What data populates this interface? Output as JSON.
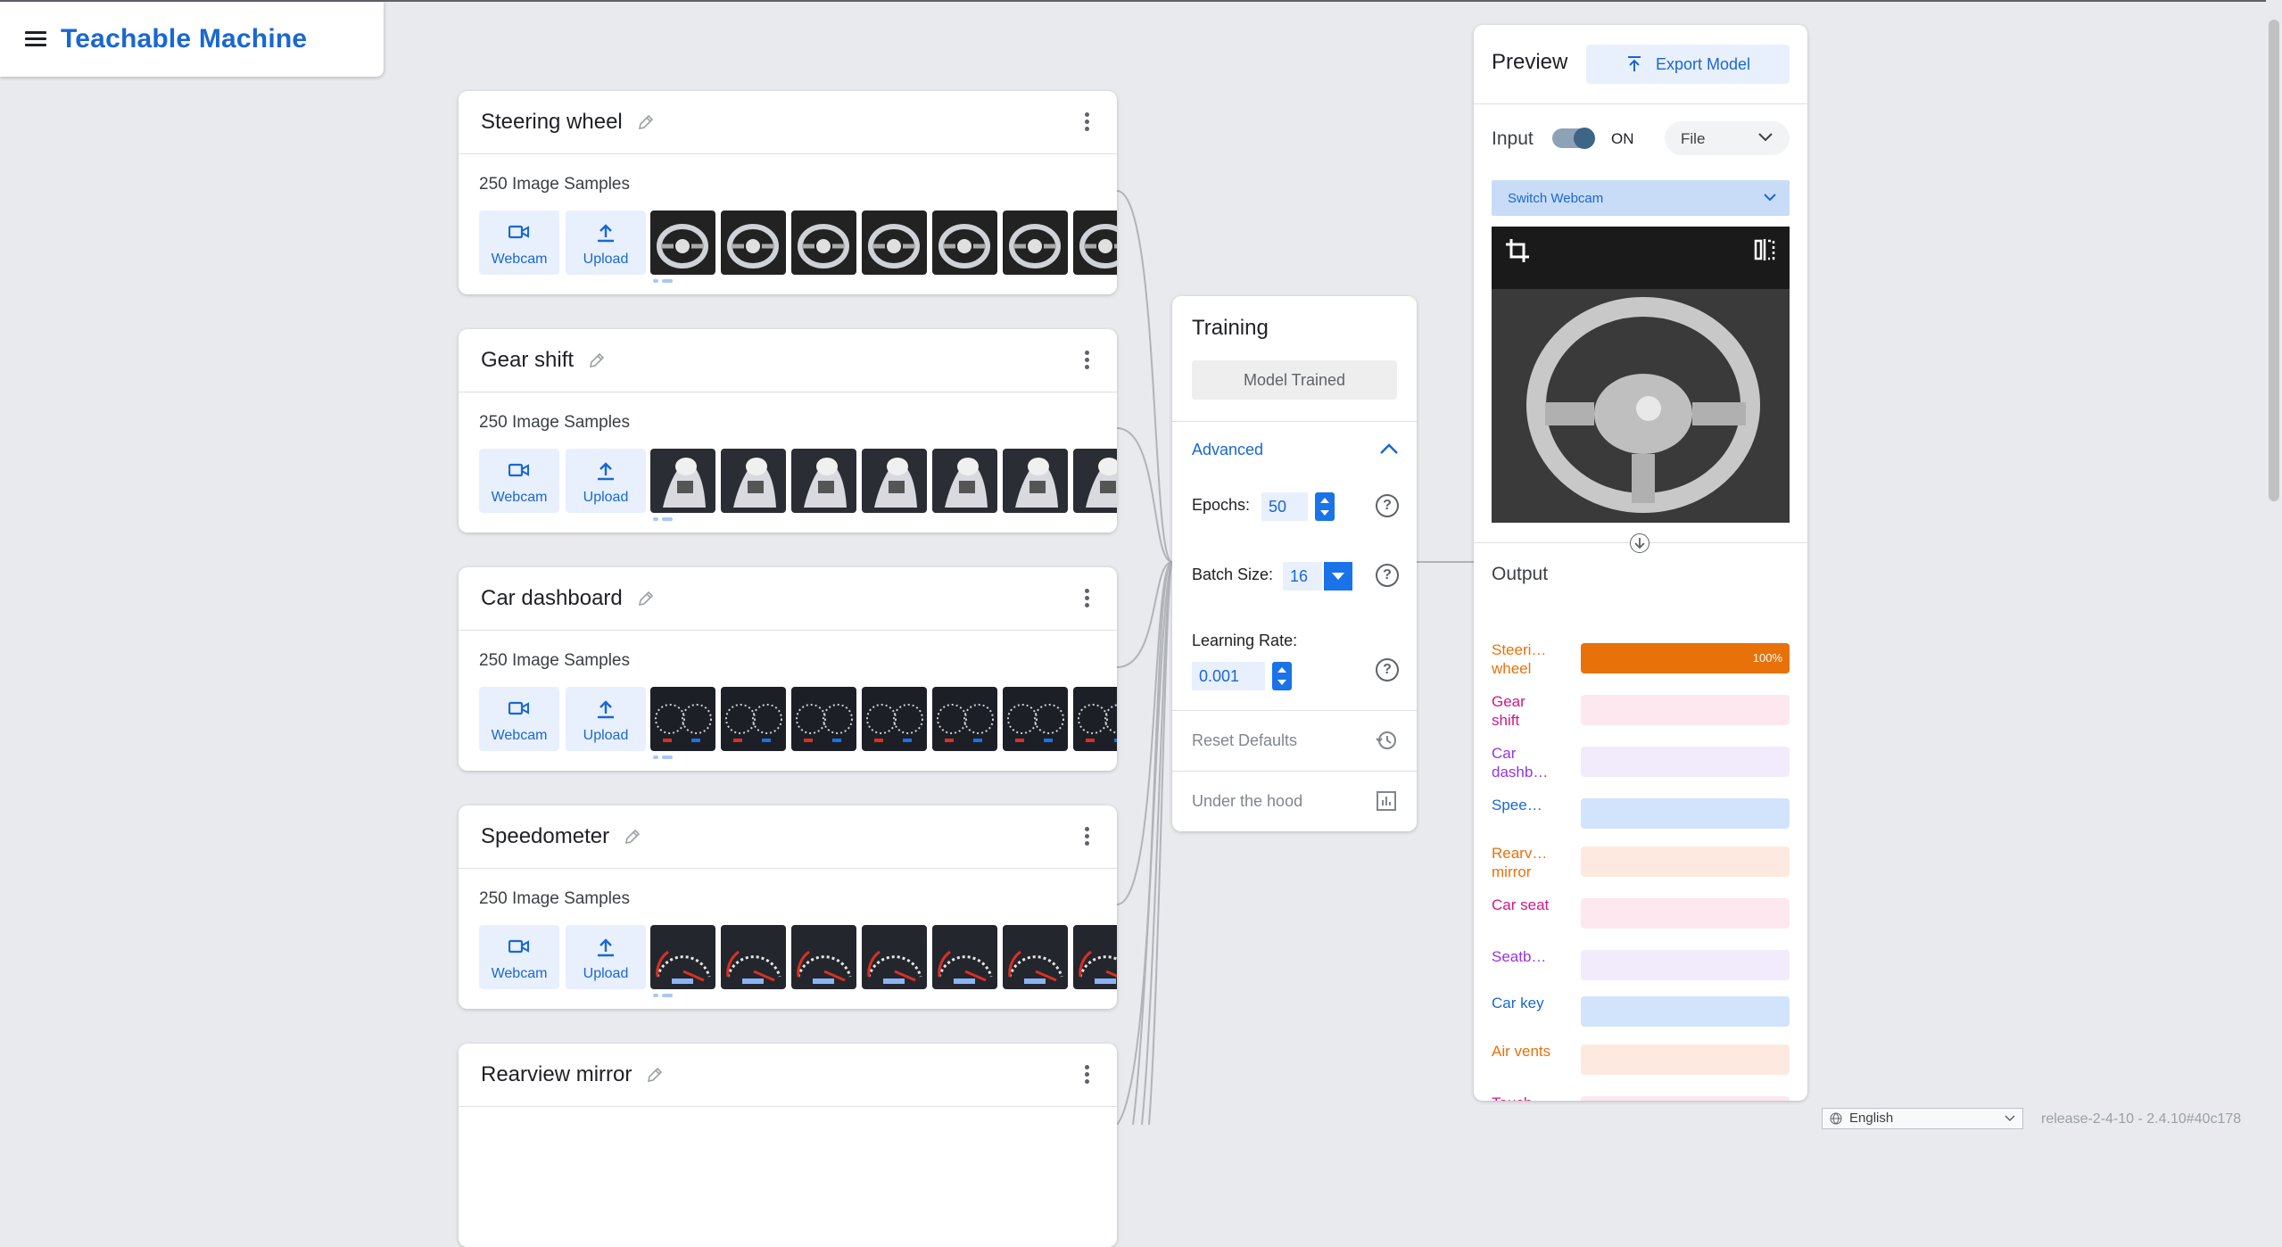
{
  "app": {
    "title": "Teachable Machine"
  },
  "classes": [
    {
      "name": "Steering wheel",
      "samples": "250 Image Samples",
      "webcam_label": "Webcam",
      "upload_label": "Upload"
    },
    {
      "name": "Gear shift",
      "samples": "250 Image Samples",
      "webcam_label": "Webcam",
      "upload_label": "Upload"
    },
    {
      "name": "Car dashboard",
      "samples": "250 Image Samples",
      "webcam_label": "Webcam",
      "upload_label": "Upload"
    },
    {
      "name": "Speedometer",
      "samples": "250 Image Samples",
      "webcam_label": "Webcam",
      "upload_label": "Upload"
    },
    {
      "name": "Rearview mirror"
    }
  ],
  "training": {
    "title": "Training",
    "status_button": "Model Trained",
    "advanced_label": "Advanced",
    "epochs_label": "Epochs:",
    "epochs_value": "50",
    "batch_label": "Batch Size:",
    "batch_value": "16",
    "lr_label": "Learning Rate:",
    "lr_value": "0.001",
    "help_glyph": "?",
    "reset_label": "Reset Defaults",
    "hood_label": "Under the hood"
  },
  "preview": {
    "title": "Preview",
    "export_label": "Export Model",
    "input_label": "Input",
    "toggle_state": "ON",
    "source_select": "File",
    "switch_webcam_label": "Switch Webcam",
    "output_title": "Output",
    "outputs": [
      {
        "label": "Steeri… wheel",
        "color": "#e8710a",
        "bg": "#fde7e9",
        "confidence": 1.0,
        "pct_text": "100%"
      },
      {
        "label": "Gear shift",
        "color": "#d01884",
        "bg": "#fce8ee",
        "confidence": 0
      },
      {
        "label": "Car dashb…",
        "color": "#9334e6",
        "bg": "#f1ebfc",
        "confidence": 0
      },
      {
        "label": "Spee…",
        "color": "#1967d2",
        "bg": "#d2e3fc",
        "confidence": 0
      },
      {
        "label": "Rearv… mirror",
        "color": "#e8710a",
        "bg": "#fde9df",
        "confidence": 0
      },
      {
        "label": "Car seat",
        "color": "#d01884",
        "bg": "#fce8ee",
        "confidence": 0
      },
      {
        "label": "Seatb…",
        "color": "#9334e6",
        "bg": "#f1ebfc",
        "confidence": 0
      },
      {
        "label": "Car key",
        "color": "#1967d2",
        "bg": "#d2e3fc",
        "confidence": 0
      },
      {
        "label": "Air vents",
        "color": "#e8710a",
        "bg": "#fde9df",
        "confidence": 0
      },
      {
        "label": "Touch… displa…",
        "color": "#d01884",
        "bg": "#fce8ee",
        "confidence": 0
      }
    ]
  },
  "footer": {
    "language": "English",
    "version": "release-2-4-10 - 2.4.10#40c178"
  }
}
